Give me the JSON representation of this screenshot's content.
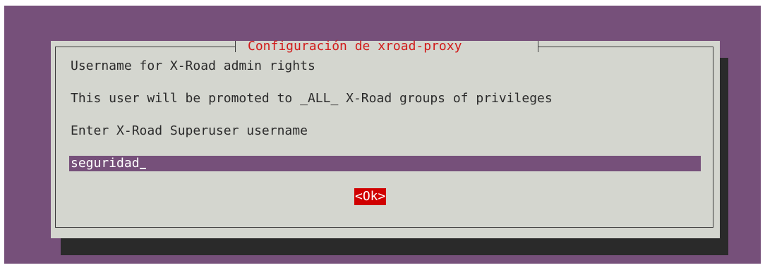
{
  "dialog": {
    "title": "Configuración de xroad-proxy",
    "lines": [
      "Username for X-Road admin rights",
      "This user will be promoted to _ALL_ X-Road groups of privileges",
      "Enter X-Road Superuser username"
    ],
    "input_value": "seguridad",
    "ok_label": "<Ok>"
  },
  "colors": {
    "terminal_bg": "#76507a",
    "dialog_bg": "#d4d6cf",
    "title_text": "#d11a1a",
    "button_bg": "#d00000"
  }
}
